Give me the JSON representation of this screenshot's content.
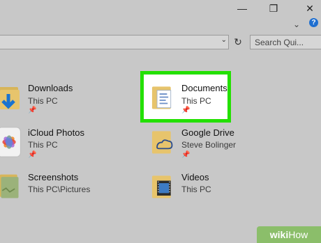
{
  "window": {
    "minimize_label": "—",
    "restore_label": "❐",
    "close_label": "✕",
    "ribbon_toggle": "⌄",
    "help_label": "?"
  },
  "address": {
    "dropdown": "⌄",
    "refresh": "↻",
    "search_placeholder": "Search Qui..."
  },
  "items": [
    {
      "title": "Downloads",
      "subtitle": "This PC",
      "pinned": true
    },
    {
      "title": "Documents",
      "subtitle": "This PC",
      "pinned": true
    },
    {
      "title": "iCloud Photos",
      "subtitle": "This PC",
      "pinned": true
    },
    {
      "title": "Google Drive",
      "subtitle": "Steve Bolinger",
      "pinned": true
    },
    {
      "title": "Screenshots",
      "subtitle": "This PC\\Pictures",
      "pinned": false
    },
    {
      "title": "Videos",
      "subtitle": "This PC",
      "pinned": false
    }
  ],
  "brand": {
    "wiki": "wiki",
    "how": "How"
  },
  "colors": {
    "highlight": "#23e000",
    "folder": "#e7c46c",
    "accent": "#1f6fd0"
  }
}
